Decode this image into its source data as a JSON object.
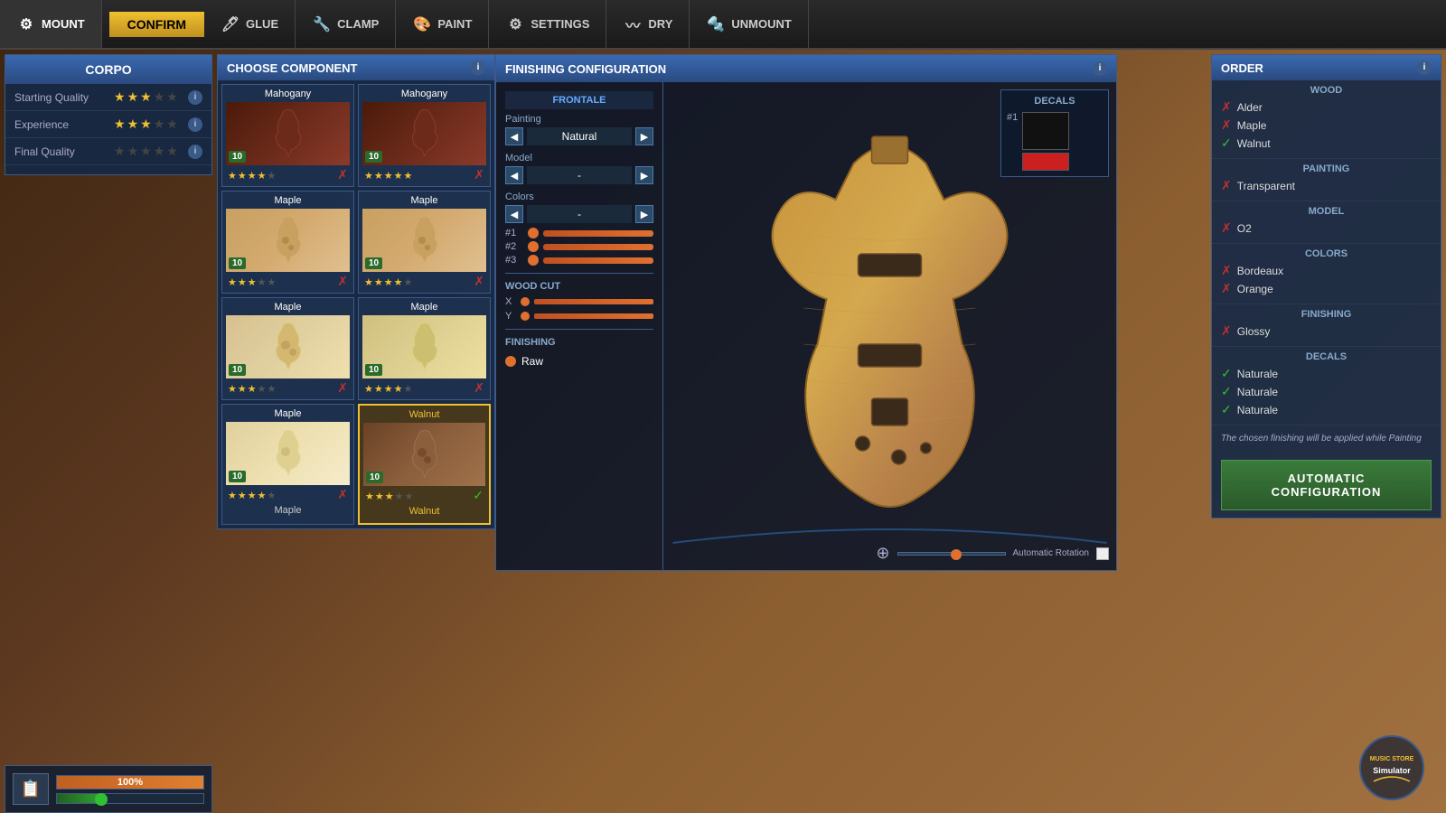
{
  "nav": {
    "items": [
      {
        "label": "MOUNT",
        "icon": "⚙",
        "active": true
      },
      {
        "label": "GLUE",
        "icon": "🖌",
        "active": false
      },
      {
        "label": "CLAMP",
        "icon": "🔧",
        "active": false
      },
      {
        "label": "PAINT",
        "icon": "🎨",
        "active": false
      },
      {
        "label": "SETTINGS",
        "icon": "⚙",
        "active": false
      },
      {
        "label": "DRY",
        "icon": "〰",
        "active": false
      },
      {
        "label": "UNMOUNT",
        "icon": "🔩",
        "active": false
      }
    ],
    "confirm_label": "CONFIRM"
  },
  "corpo_panel": {
    "title": "CORPO",
    "starting_quality_label": "Starting Quality",
    "experience_label": "Experience",
    "final_quality_label": "Final Quality",
    "starting_stars": 3,
    "experience_stars": 3,
    "final_stars": 0,
    "total_stars": 5
  },
  "component_panel": {
    "title": "CHOOSE COMPONENT",
    "components": [
      {
        "name": "Mahogany",
        "quality": 10,
        "stars": 4,
        "type": "dark",
        "bottom_label": ""
      },
      {
        "name": "Mahogany",
        "quality": 10,
        "stars": 5,
        "type": "dark",
        "bottom_label": ""
      },
      {
        "name": "Maple",
        "quality": 10,
        "stars": 3,
        "type": "light",
        "bottom_label": ""
      },
      {
        "name": "Maple",
        "quality": 10,
        "stars": 4,
        "type": "light",
        "bottom_label": ""
      },
      {
        "name": "Maple",
        "quality": 10,
        "stars": 3,
        "type": "light2",
        "bottom_label": ""
      },
      {
        "name": "Maple",
        "quality": 10,
        "stars": 4,
        "type": "light2",
        "bottom_label": ""
      },
      {
        "name": "Maple",
        "quality": 10,
        "stars": 4,
        "selected": false,
        "type": "light3",
        "bottom_label": "Maple"
      },
      {
        "name": "Walnut",
        "quality": 10,
        "stars": 3,
        "selected": true,
        "type": "walnut",
        "bottom_label": "Walnut"
      }
    ]
  },
  "finishing_config": {
    "title": "FINISHING CONFIGURATION",
    "frontale_label": "FRONTALE",
    "painting_label": "Painting",
    "painting_value": "Natural",
    "model_label": "Model",
    "model_value": "-",
    "colors_label": "Colors",
    "colors_value": "-",
    "color1_num": "#1",
    "color2_num": "#2",
    "color3_num": "#3",
    "wood_cut_label": "WOOD CUT",
    "wood_x_label": "X",
    "wood_y_label": "Y",
    "finishing_label": "FINISHING",
    "finishing_raw": "Raw"
  },
  "decals": {
    "title": "DECALS",
    "num1": "#1",
    "num2": "(unused)",
    "black_swatch": "#111",
    "red_swatch": "#cc2020"
  },
  "order_panel": {
    "title": "ORDER",
    "wood_title": "WOOD",
    "wood_items": [
      {
        "label": "Alder",
        "status": "bad"
      },
      {
        "label": "Maple",
        "status": "bad"
      },
      {
        "label": "Walnut",
        "status": "ok"
      }
    ],
    "painting_title": "PAINTING",
    "painting_items": [
      {
        "label": "Transparent",
        "status": "bad"
      }
    ],
    "model_title": "MODEL",
    "model_items": [
      {
        "label": "O2",
        "status": "bad"
      }
    ],
    "colors_title": "COLORS",
    "colors_items": [
      {
        "label": "Bordeaux",
        "status": "bad"
      },
      {
        "label": "Orange",
        "status": "bad"
      }
    ],
    "finishing_title": "FINISHING",
    "finishing_items": [
      {
        "label": "Glossy",
        "status": "bad"
      }
    ],
    "decals_title": "DECALS",
    "decals_items": [
      {
        "label": "Naturale",
        "status": "ok"
      },
      {
        "label": "Naturale",
        "status": "ok"
      },
      {
        "label": "Naturale",
        "status": "ok"
      }
    ],
    "hint": "The chosen finishing will be applied while Painting",
    "auto_config_label": "AUTOMATIC\nCONFIGURATION"
  },
  "bottom_bar": {
    "progress_percent": "100%",
    "icon": "📋"
  },
  "rotation": {
    "label": "Automatic Rotation"
  }
}
